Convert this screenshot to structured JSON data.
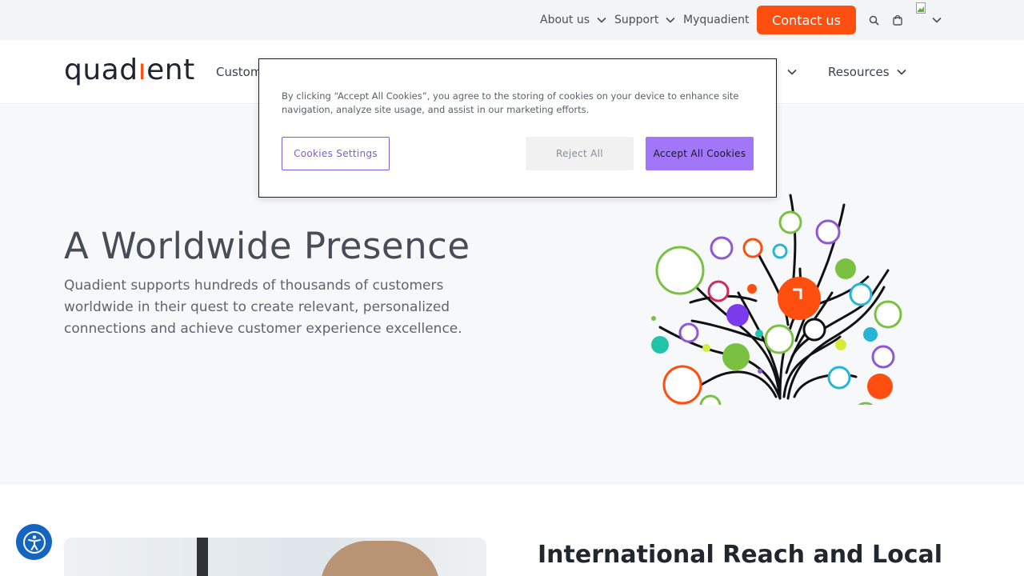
{
  "utility_bar": {
    "about_label": "About us",
    "support_label": "Support",
    "myquadient_label": "Myquadient",
    "contact_label": "Contact us",
    "icons": [
      "search-icon",
      "cart-icon",
      "flag-image",
      "chevron-down-icon"
    ]
  },
  "nav": {
    "logo": {
      "prefix": "quad",
      "accent": "ı",
      "suffix": "ent"
    },
    "items": [
      {
        "label": "Customer"
      },
      {
        "label": "Resources"
      }
    ]
  },
  "hero": {
    "title": "A Worldwide Presence",
    "text": "Quadient supports hundreds of thousands of customers worldwide in their quest to create relevant, personalized connections and achieve customer experience excellence."
  },
  "section": {
    "title": "International Reach and Local"
  },
  "cookie_banner": {
    "text": "By clicking “Accept All Cookies”, you agree to the storing of cookies on your device to enhance site navigation, analyze site usage, and assist in our marketing efforts.",
    "settings_label": "Cookies Settings",
    "reject_label": "Reject All",
    "accept_label": "Accept All Cookies"
  },
  "colors": {
    "brand_orange": "#fe4f10",
    "cookie_purple": "#a177f7",
    "settings_purple": "#7d5dd7",
    "a11y_blue": "#1565c0"
  }
}
